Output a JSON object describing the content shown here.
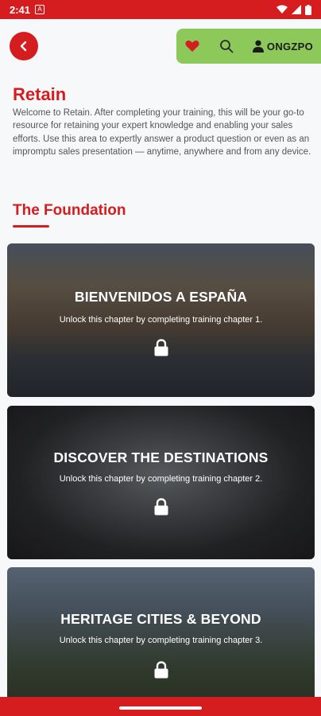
{
  "status_bar": {
    "time": "2:41",
    "notification_glyph": "A"
  },
  "header": {
    "user_name": "ONGZPO"
  },
  "page": {
    "title": "Retain",
    "intro": "Welcome to Retain. After completing your training, this will be your go-to resource for retaining your expert knowledge and enabling your sales efforts. Use this area to expertly answer a product question or even as an impromptu sales presentation — anytime, anywhere and from any device."
  },
  "section": {
    "title": "The Foundation"
  },
  "cards": [
    {
      "title": "BIENVENIDOS A ESPAÑA",
      "subtitle": "Unlock this chapter by completing training chapter 1."
    },
    {
      "title": "DISCOVER THE DESTINATIONS",
      "subtitle": "Unlock this chapter by completing training chapter 2."
    },
    {
      "title": "HERITAGE CITIES & BEYOND",
      "subtitle": "Unlock this chapter by completing training chapter 3."
    }
  ],
  "colors": {
    "brand_red": "#d51d1f",
    "toolbar_green": "#8dc95a",
    "background": "#f7f8fa"
  },
  "icons": [
    "back-arrow-icon",
    "heart-icon",
    "search-icon",
    "user-icon",
    "lock-icon",
    "wifi-icon",
    "signal-icon",
    "battery-icon"
  ]
}
